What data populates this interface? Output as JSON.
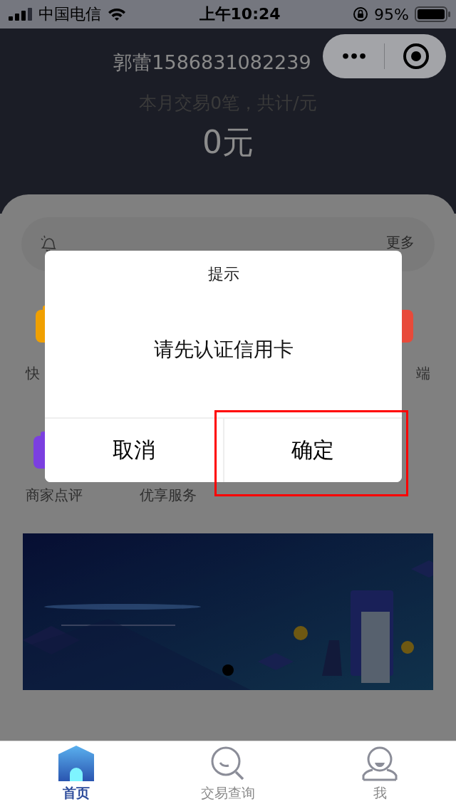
{
  "status_bar": {
    "carrier": "中国电信",
    "time": "上午10:24",
    "battery": "95%"
  },
  "header": {
    "account": "郭蕾1586831082239",
    "month_summary": "本月交易0笔，共计/元",
    "amount": "0元"
  },
  "capsule": {
    "more": "•••"
  },
  "notice": {
    "more": "更多"
  },
  "shortcuts": [
    {
      "label": "快",
      "color": "#f0a000"
    },
    {
      "label": "端",
      "color": "#e84a3a"
    }
  ],
  "shortcuts_row2": [
    {
      "label": "商家点评",
      "color": "#7b3fe0"
    },
    {
      "label": "优享服务"
    }
  ],
  "banner": {
    "kind": "picture",
    "pages": [
      {
        "selected": true
      }
    ]
  },
  "dialog": {
    "title": "提示",
    "message": "请先认证信用卡",
    "buttons": [
      {
        "label": "取消",
        "highlighted": false
      },
      {
        "label": "确定",
        "highlighted": true
      }
    ]
  },
  "tab_bar": [
    {
      "label": "首页",
      "selected": true
    },
    {
      "label": "交易查询",
      "selected": false
    },
    {
      "label": "我",
      "selected": false
    }
  ]
}
